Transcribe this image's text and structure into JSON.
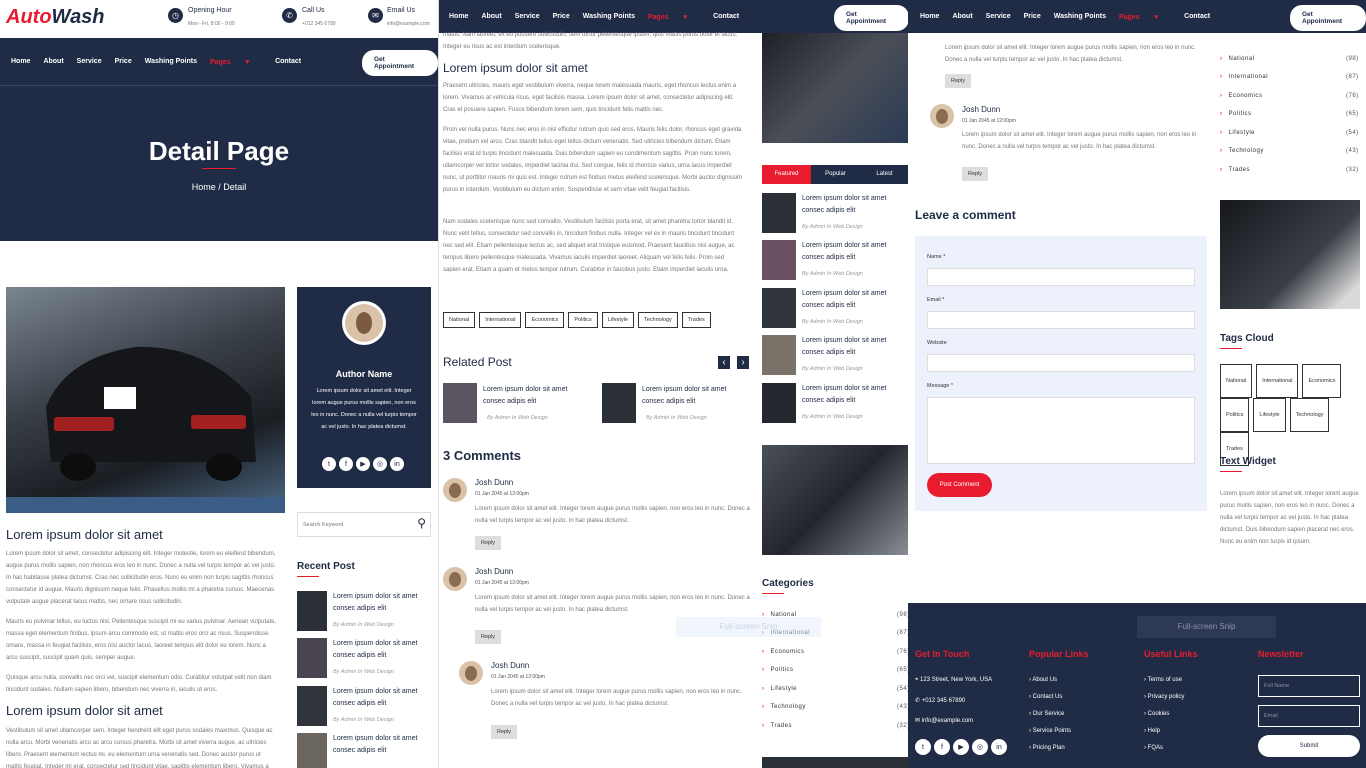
{
  "brand": {
    "a": "Auto",
    "b": "Wash"
  },
  "topbar": {
    "hours_title": "Opening Hour",
    "hours": "Mon - Fri, 8:00 - 9:00",
    "call_title": "Call Us",
    "phone": "+012 345 6789",
    "email_title": "Email Us",
    "email": "info@example.com"
  },
  "nav": {
    "items": [
      "Home",
      "About",
      "Service",
      "Price",
      "Washing Points",
      "Pages",
      "Contact"
    ],
    "active": "Pages",
    "cta": "Get Appointment"
  },
  "hero": {
    "title": "Detail Page",
    "crumb_home": "Home",
    "crumb_sep": "/",
    "crumb_current": "Detail"
  },
  "article": {
    "heading": "Lorem ipsum dolor sit amet",
    "p1": "Lorem ipsum dolor sit amet, consectetur adipiscing elit. Integer molestie, lorem eu eleifend bibendum, augue purus mollis sapien, non rhoncus eros leo in nunc. Donec a nulla vel turpis tempor ac vel justo. In hac habitasse platea dictumst. Cras nec sollicitudin eros. Nunc eu enim non turpis sagittis rhoncus consectetur id augue. Mauris dignissim neque felis. Phasellus mollis mi a pharetra cursus. Maecenas vulputate augue placerat lacus mattis, nec ornare risus sollicitudin.",
    "p2": "Mauris eu pulvinar tellus, eu luctus nisl. Pellentesque suscipit mi eu varius pulvinar. Aenean vulputate, massa eget elementum finibus, ipsum arcu commodo est, ut mattis eros orci ac risus. Suspendisse ornare, massa in feugiat facilisis, eros nisi auctor lacus, laoreet tempus elit dolor eu lorem. Nunc a arcu suscipit, suscipit quam quis, semper augue.",
    "p3": "Quisque arcu nulla, convallis nec orci vel, suscipit elementum odio. Curabitur volutpat velit non diam tincidunt sodales. Nullam sapien libero, bibendum nec viverra in, iaculis ut eros.",
    "heading2": "Lorem ipsum dolor sit amet",
    "p4": "Vestibulum sit amet ullamcorper sem. Integer hendrerit elit eget purus sodales maximus. Quisque ac nulla arcu. Morbi venenatis arcu ac arcu cursus pharetra. Morbi sit amet viverra augue, ac ultricies libero. Praesent elementum lectus mi, eu elementum urna venenatis sed. Donec auctor purus ut mattis feugiat. Integer mi erat, consectetur sed tincidunt vitae, sagittis elementum libero. Vivamus a ultrices erat."
  },
  "author": {
    "name": "Author Name",
    "bio": "Lorem ipsum dolor sit amet elit. Integer lorem augue purus mollis sapien, non eros leo in nunc. Donec a nulla vel turpis tempor ac vel justo. In hac platea dictumst."
  },
  "search": {
    "placeholder": "Search Keyword"
  },
  "recent": {
    "title": "Recent Post",
    "item": "Lorem ipsum dolor sit amet consec adipis elit",
    "meta": "By Admin  In Web Design"
  },
  "mid": {
    "top_text": "mattis. Nam laoreet, ex eu posuere sollicitudin, sem tortor pellentesque ipsum, quis mattis purus dolor et lacus. Integer eu risus ac est interdum scelerisque.",
    "heading": "Lorem ipsum dolor sit amet",
    "p1": "Praesent ultricies, mauris eget vestibulum viverra, neque lorem malesuada mauris, eget rhoncus lectus enim a lorem. Vivamus at vehicula risus, eget facilisis massa. Lorem ipsum dolor sit amet, consectetur adipiscing elit. Cras et posuere sapien. Fusce bibendum lorem sem, quis tincidunt felis mattis nec.",
    "p2": "Proin vel nulla purus. Nunc nec eros in nisl efficitur rutrum quis sed eros. Mauris felis dolor, rhoncus eget gravida vitae, pretium vel arcu. Cras blandit tellus eget tellus dictum venenatis. Sed ultricies bibendum dictum. Etiam facilisis erat id turpis tincidunt malesuada. Duis bibendum sapien eu condimentum sagittis. Proin nunc lorem, ullamcorper vel tortor sodales, imperdiet lacinia dui. Sed congue, felis id rhoncus varius, urna lacus imperdiet nunc, ut porttitor mauris mi quis est. Integer rutrum est finibus metus eleifend scelerisque. Morbi auctor dignissim purus in interdum. Vestibulum eu dictum enim. Suspendisse et sem vitae velit feugiat facilisis.",
    "p3": "Nam sodales scelerisque nunc sed convallis. Vestibulum facilisis porta erat, sit amet pharetra tortor blandit id. Nunc velit tellus, consectetur sed convallis in, tincidunt finibus nulla. Integer vel ex in mauris tincidunt tincidunt nec sed elit. Etiam pellentesque lectus ac, sed aliquet erat tristique euismod. Praesent faucibus nisl augue, ac tempus libero pellentesque malesuada. Vivamus iaculis imperdiet laoreet. Aliquam vel felis felis. Proin sed sapien erat. Etiam a quam et metus tempor rutrum. Curabitur in faucibus justo. Etiam imperdiet iaculis urna."
  },
  "tags": [
    "National",
    "International",
    "Economics",
    "Politics",
    "Lifestyle",
    "Technology",
    "Trades"
  ],
  "related": {
    "title": "Related Post",
    "item": "Lorem ipsum dolor sit amet consec adipis elit",
    "meta": "By Admin  In Web Design",
    "prev": "‹",
    "next": "›"
  },
  "comments": {
    "title": "3 Comments",
    "name": "Josh Dunn",
    "date": "01 Jan 2045 at 12:00pm",
    "text": "Lorem ipsum dolor sit amet elit. Integer lorem augue purus mollis sapien, non eros leo in nunc. Donec a nulla vel turpis tempor ac vel justo. In hac platea dictumst.",
    "reply": "Reply"
  },
  "tabs": {
    "featured": "Featured",
    "popular": "Popular",
    "latest": "Latest"
  },
  "categories": {
    "title": "Categories",
    "items": [
      {
        "name": "National",
        "count": "(98)"
      },
      {
        "name": "International",
        "count": "(87)"
      },
      {
        "name": "Economics",
        "count": "(76)"
      },
      {
        "name": "Politics",
        "count": "(65)"
      },
      {
        "name": "Lifestyle",
        "count": "(54)"
      },
      {
        "name": "Technology",
        "count": "(43)"
      },
      {
        "name": "Trades",
        "count": "(32)"
      }
    ]
  },
  "leave": {
    "title": "Leave a comment",
    "name": "Name *",
    "email": "Email *",
    "website": "Website",
    "message": "Message *",
    "submit": "Post Comment"
  },
  "tagscloud": {
    "title": "Tags Cloud"
  },
  "textwidget": {
    "title": "Text Widget",
    "text": "Lorem ipsum dolor sit amet elit. Integer lorem augue purus mollis sapien, non eros leo in nunc. Donec a nulla vel turpis tempor ac vel justo. In hac platea dictumst. Duis bibendum sapien placerat nec eros. Nunc eu enim non turpis id ipsum."
  },
  "footer": {
    "touch_title": "Get In Touch",
    "address": "123 Street, New York, USA",
    "phone": "+012 345 67890",
    "email": "info@example.com",
    "popular_title": "Popular Links",
    "popular": [
      "About Us",
      "Contact Us",
      "Our Service",
      "Service Points",
      "Pricing Plan"
    ],
    "useful_title": "Useful Links",
    "useful": [
      "Terms of use",
      "Privacy policy",
      "Cookies",
      "Help",
      "FQAs"
    ],
    "news_title": "Newsletter",
    "full_name": "Full Name",
    "email_ph": "Email",
    "submit": "Submit"
  },
  "snip": "Full-screen Snip",
  "colors": {
    "navy": "#202c45",
    "red": "#e81c2e"
  }
}
